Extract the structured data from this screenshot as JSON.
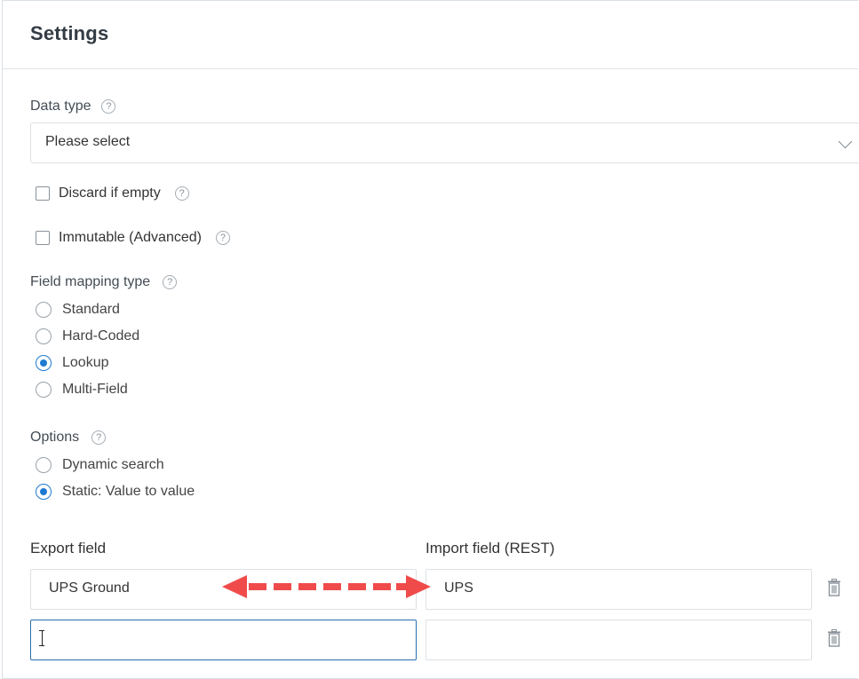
{
  "header": {
    "title": "Settings"
  },
  "data_type": {
    "label": "Data type",
    "help_icon": "question-circle-icon",
    "selected_value": "Please select"
  },
  "checkboxes": [
    {
      "label": "Discard if empty",
      "checked": false
    },
    {
      "label": "Immutable (Advanced)",
      "checked": false
    }
  ],
  "field_mapping_type": {
    "label": "Field mapping type",
    "options": [
      {
        "label": "Standard",
        "selected": false
      },
      {
        "label": "Hard-Coded",
        "selected": false
      },
      {
        "label": "Lookup",
        "selected": true
      },
      {
        "label": "Multi-Field",
        "selected": false
      }
    ]
  },
  "options": {
    "label": "Options",
    "choices": [
      {
        "label": "Dynamic search",
        "selected": false
      },
      {
        "label": "Static: Value to value",
        "selected": true
      }
    ]
  },
  "mapping_table": {
    "export_header": "Export field",
    "import_header": "Import field (REST)",
    "rows": [
      {
        "export_value": "UPS Ground",
        "import_value": "UPS"
      },
      {
        "export_value": "",
        "import_value": ""
      }
    ]
  },
  "colors": {
    "accent": "#1f7ad1",
    "annotation_arrow": "#f04b4b"
  }
}
